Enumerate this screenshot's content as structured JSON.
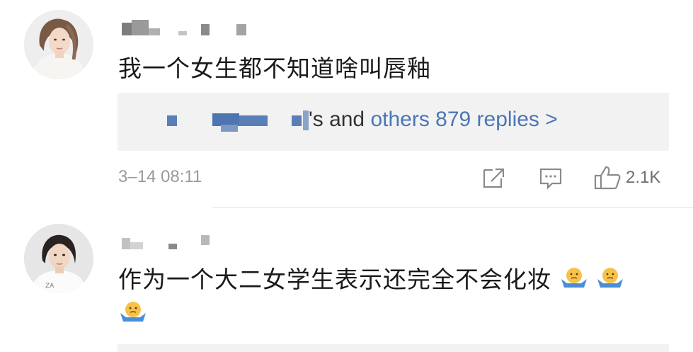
{
  "comments": [
    {
      "text": "我一个女生都不知道啥叫唇釉",
      "replies": {
        "prefix": "'s and ",
        "link": "others 879 replies >"
      },
      "time": "3–14 08:11",
      "likes": "2.1K",
      "icons": [
        "share-icon",
        "comment-icon",
        "like-icon"
      ]
    },
    {
      "text": "作为一个大二女学生表示还完全不会化妆",
      "emoji": "shrug-emoji"
    }
  ],
  "colors": {
    "link": "#4a76b7",
    "meta": "#9a9a9a",
    "reply_bg": "#f2f2f2",
    "mosaic": "#4a76b7"
  }
}
